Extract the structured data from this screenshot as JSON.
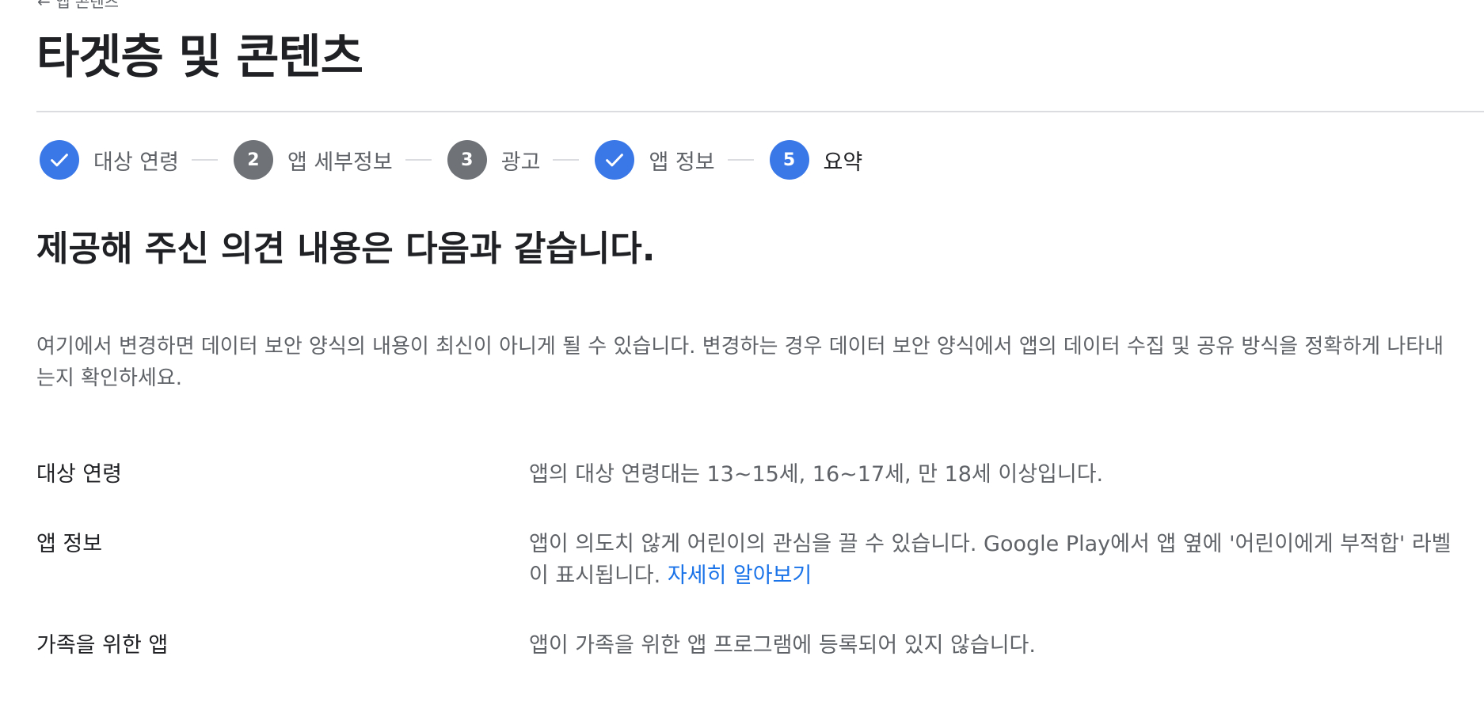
{
  "header": {
    "back_label": "앱 콘텐츠",
    "title": "타겟층 및 콘텐츠"
  },
  "stepper": {
    "steps": [
      {
        "number": "1",
        "label": "대상 연령",
        "state": "done"
      },
      {
        "number": "2",
        "label": "앱 세부정보",
        "state": "pending"
      },
      {
        "number": "3",
        "label": "광고",
        "state": "pending"
      },
      {
        "number": "4",
        "label": "앱 정보",
        "state": "done"
      },
      {
        "number": "5",
        "label": "요약",
        "state": "current"
      }
    ]
  },
  "summary": {
    "heading": "제공해 주신 의견 내용은 다음과 같습니다.",
    "notice": "여기에서 변경하면 데이터 보안 양식의 내용이 최신이 아니게 될 수 있습니다. 변경하는 경우 데이터 보안 양식에서 앱의 데이터 수집 및 공유 방식을 정확하게 나타내는지 확인하세요.",
    "rows": [
      {
        "label": "대상 연령",
        "value": "앱의 대상 연령대는 13~15세, 16~17세, 만 18세 이상입니다."
      },
      {
        "label": "앱 정보",
        "value": "앱이 의도치 않게 어린이의 관심을 끌 수 있습니다. Google Play에서 앱 옆에 '어린이에게 부적합' 라벨이 표시됩니다.",
        "link": "자세히 알아보기"
      },
      {
        "label": "가족을 위한 앱",
        "value": "앱이 가족을 위한 앱 프로그램에 등록되어 있지 않습니다."
      }
    ]
  },
  "colors": {
    "accent": "#3b78e7",
    "link": "#1a73e8",
    "pending_step": "#6f7378",
    "text_primary": "#202124",
    "text_secondary": "#5f6368",
    "divider": "#dadce0"
  },
  "icons": {
    "completed_step": "check-icon"
  }
}
